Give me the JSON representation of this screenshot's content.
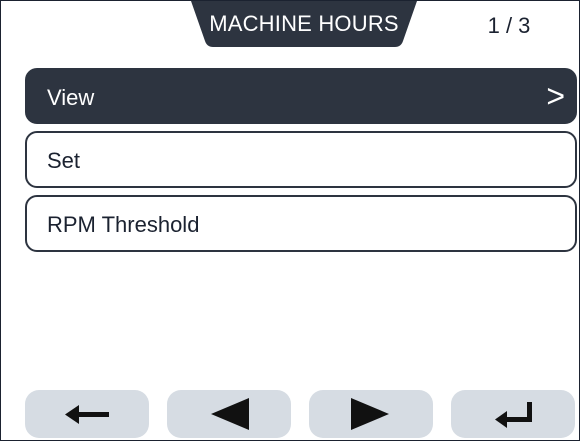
{
  "header": {
    "title": "MACHINE HOURS",
    "page_indicator": "1 / 3"
  },
  "menu": {
    "items": [
      {
        "label": "View",
        "selected": true,
        "chevron": ">"
      },
      {
        "label": "Set",
        "selected": false
      },
      {
        "label": "RPM Threshold",
        "selected": false
      }
    ]
  },
  "footer": {
    "buttons": [
      {
        "icon": "arrow-left-icon"
      },
      {
        "icon": "triangle-left-icon"
      },
      {
        "icon": "triangle-right-icon"
      },
      {
        "icon": "enter-return-icon"
      }
    ]
  },
  "colors": {
    "dark": "#2d3440",
    "button_bg": "#d6dce3",
    "text_dark": "#1b2230",
    "background": "#ffffff"
  }
}
